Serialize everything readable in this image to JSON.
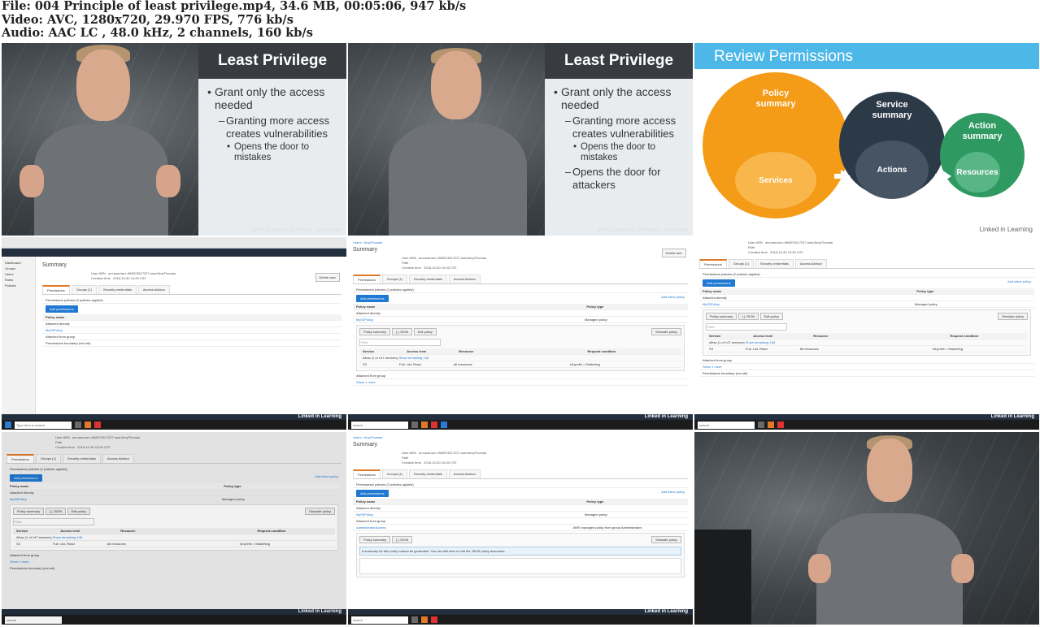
{
  "file_info": {
    "file_line": "File: 004 Principle of least privilege.mp4, 34.6 MB, 00:05:06, 947 kb/s",
    "video_line": "Video: AVC, 1280x720, 29.970 FPS, 776 kb/s",
    "audio_line": "Audio: AAC LC , 48.0 kHz, 2 channels, 160 kb/s"
  },
  "slide": {
    "title": "Least Privilege",
    "bullet1": "Grant only the access needed",
    "bullet2": "Granting more access creates vulnerabilities",
    "bullet3": "Opens the door to mistakes",
    "bullet4": "Opens the door for attackers",
    "caption": "AWS Solutions Architect - Associate",
    "watermark": "Linked in Learning"
  },
  "review": {
    "title": "Review Permissions",
    "policy_summary": "Policy summary",
    "services": "Services",
    "service_summary": "Service summary",
    "actions": "Actions",
    "action_summary": "Action summary",
    "resources": "Resources",
    "colors": {
      "header": "#4db8e8",
      "orange": "#f49b17",
      "dark": "#2c3a47",
      "green": "#2e9a62"
    }
  },
  "aws": {
    "summary": "Summary",
    "user_arn_label": "User ARN",
    "user_arn": "arn:aws:iam::968974517227:user/AmyThomas",
    "path_label": "Path",
    "creation_label": "Creation time",
    "creation_time": "2018-10-30 10:26 CST",
    "delete_user": "Delete user",
    "tab_permissions": "Permissions",
    "tab_groups": "Groups (1)",
    "tab_security": "Security credentials",
    "tab_access": "Access Advisor",
    "policies_applied": "Permissions policies (2 policies applied)",
    "add_permissions": "Add permissions",
    "add_inline": "Add inline policy",
    "policy_name": "Policy name",
    "policy_type": "Policy type",
    "attached_directly": "Attached directly",
    "my_s3_policy": "MyS3Policy",
    "managed_policy": "Managed policy",
    "attached_from_group": "Attached from group",
    "show_1_more": "Show 1 more",
    "policy_summary_btn": "Policy summary",
    "json_btn": "{ } JSON",
    "edit_policy": "Edit policy",
    "simulate_policy": "Simulate policy",
    "filter": "Filter",
    "service_col": "Service",
    "access_level_col": "Access level",
    "resource_col": "Resource",
    "request_condition_col": "Request condition",
    "allow_line": "Allow (1 of 147 services)",
    "show_remaining": "Show remaining 146",
    "s3": "S3",
    "full_list_read": "Full: List, Read",
    "all_resources": "All resources",
    "condition_value": "s3:prefix = Marketing",
    "boundary": "Permissions boundary (not set)",
    "admin_access": "AdministratorAccess",
    "aws_managed_group": "AWS managed policy from group Administrators",
    "json_notice": "A summary for this policy cannot be generated. You can still view or edit the JSON policy document.",
    "breadcrumb_users": "Users",
    "breadcrumb_user": "AmyThomas",
    "search": "search",
    "type_here": "Type here to search",
    "linked_in": "Linked in Learning"
  }
}
